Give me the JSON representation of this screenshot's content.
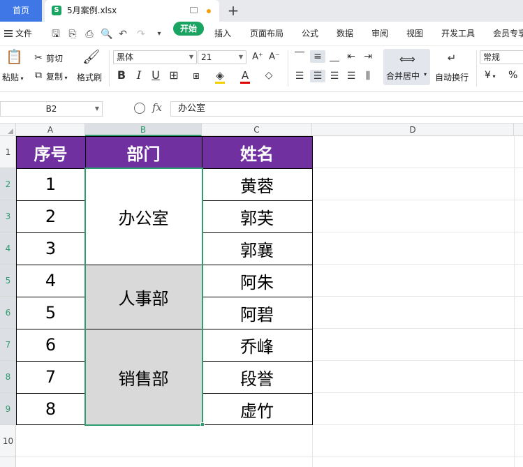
{
  "titlebar": {
    "home_tab": "首页",
    "file_tab": "5月案例.xlsx",
    "file_icon": "S",
    "add_tab": "+"
  },
  "menu": {
    "file": "文件",
    "items": [
      "开始",
      "插入",
      "页面布局",
      "公式",
      "数据",
      "审阅",
      "视图",
      "开发工具",
      "会员专享"
    ]
  },
  "ribbon": {
    "paste": "粘贴",
    "cut": "剪切",
    "copy": "复制",
    "format_painter": "格式刷",
    "font_name": "黑体",
    "font_size": "21",
    "merge_center": "合并居中",
    "wrap_text": "自动换行",
    "number_format": "常规",
    "currency_symbol": "¥",
    "percent_symbol": "%",
    "bold": "B",
    "italic": "I",
    "underline": "U"
  },
  "formula_bar": {
    "name_box": "B2",
    "fx": "fx",
    "value": "办公室"
  },
  "columns": [
    "A",
    "B",
    "C",
    "D"
  ],
  "rows": [
    "1",
    "2",
    "3",
    "4",
    "5",
    "6",
    "7",
    "8",
    "9",
    "10"
  ],
  "table": {
    "headers": [
      "序号",
      "部门",
      "姓名"
    ],
    "numbers": [
      "1",
      "2",
      "3",
      "4",
      "5",
      "6",
      "7",
      "8"
    ],
    "departments": [
      "办公室",
      "人事部",
      "销售部"
    ],
    "names": [
      "黄蓉",
      "郭芙",
      "郭襄",
      "阿朱",
      "阿碧",
      "乔峰",
      "段誉",
      "虚竹"
    ]
  },
  "colors": {
    "header_fill": "#7030a0",
    "merged_fill": "#d9d9d9",
    "selection": "#2e9c6e",
    "accent": "#1aa462"
  }
}
